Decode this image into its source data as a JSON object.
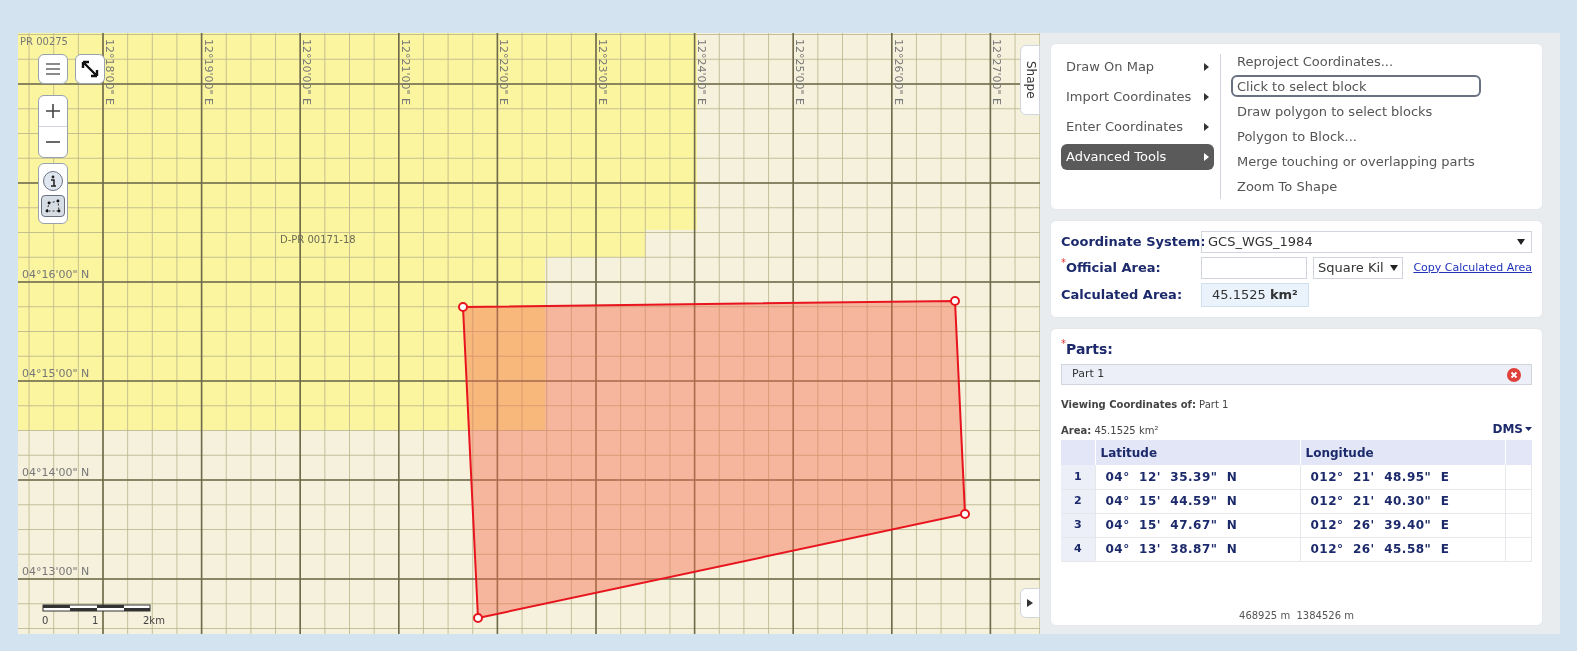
{
  "map": {
    "corner_label": "PR 00275",
    "block_label": "D-PR 00171-18",
    "longitude_labels": [
      "12°18'00\" E",
      "12°19'00\" E",
      "12°20'00\" E",
      "12°21'00\" E",
      "12°22'00\" E",
      "12°23'00\" E",
      "12°24'00\" E",
      "12°25'00\" E",
      "12°26'00\" E",
      "12°27'00\" E"
    ],
    "latitude_labels": [
      "04°16'00\" N",
      "04°15'00\" N",
      "04°14'00\" N",
      "04°13'00\" N"
    ],
    "scale_labels": [
      "0",
      "1",
      "2km"
    ],
    "shape_tab": "Shape"
  },
  "menu": {
    "items": [
      {
        "label": "Draw On Map",
        "selected": false
      },
      {
        "label": "Import Coordinates",
        "selected": false
      },
      {
        "label": "Enter Coordinates",
        "selected": false
      },
      {
        "label": "Advanced Tools",
        "selected": true
      }
    ],
    "submenu": [
      {
        "label": "Reproject Coordinates...",
        "selected": false
      },
      {
        "label": "Click to select block",
        "selected": true
      },
      {
        "label": "Draw polygon to select blocks",
        "selected": false
      },
      {
        "label": "Polygon to Block...",
        "selected": false
      },
      {
        "label": "Merge touching or overlapping parts",
        "selected": false
      },
      {
        "label": "Zoom To Shape",
        "selected": false
      }
    ]
  },
  "coordinates": {
    "system_label": "Coordinate System:",
    "system_value": "GCS_WGS_1984",
    "required_mark": "*",
    "official_label": "Official Area:",
    "unit": "Square Kil",
    "copy_link": "Copy Calculated Area",
    "calculated_label": "Calculated Area:",
    "calculated_value": "45.1525 **km²**"
  },
  "parts": {
    "required_mark": "*",
    "label": "Parts:",
    "items": [
      {
        "label": "Part 1"
      }
    ],
    "viewing": "**Viewing Coordinates of:** Part 1",
    "area": "**Area:** 45.1525 km²",
    "format": "DMS",
    "columns": [
      "Latitude",
      "Longitude"
    ],
    "rows": [
      {
        "index": "1",
        "latitude": "04°  12'  35.39\"  N",
        "longitude": "012°  21'  48.95\"  E"
      },
      {
        "index": "2",
        "latitude": "04°  15'  44.59\"  N",
        "longitude": "012°  21'  40.30\"  E"
      },
      {
        "index": "3",
        "latitude": "04°  15'  47.67\"  N",
        "longitude": "012°  26'  39.40\"  E"
      },
      {
        "index": "4",
        "latitude": "04°  13'  38.87\"  N",
        "longitude": "012°  26'  45.58\"  E"
      }
    ]
  },
  "status": "468925 m  1384526 m"
}
